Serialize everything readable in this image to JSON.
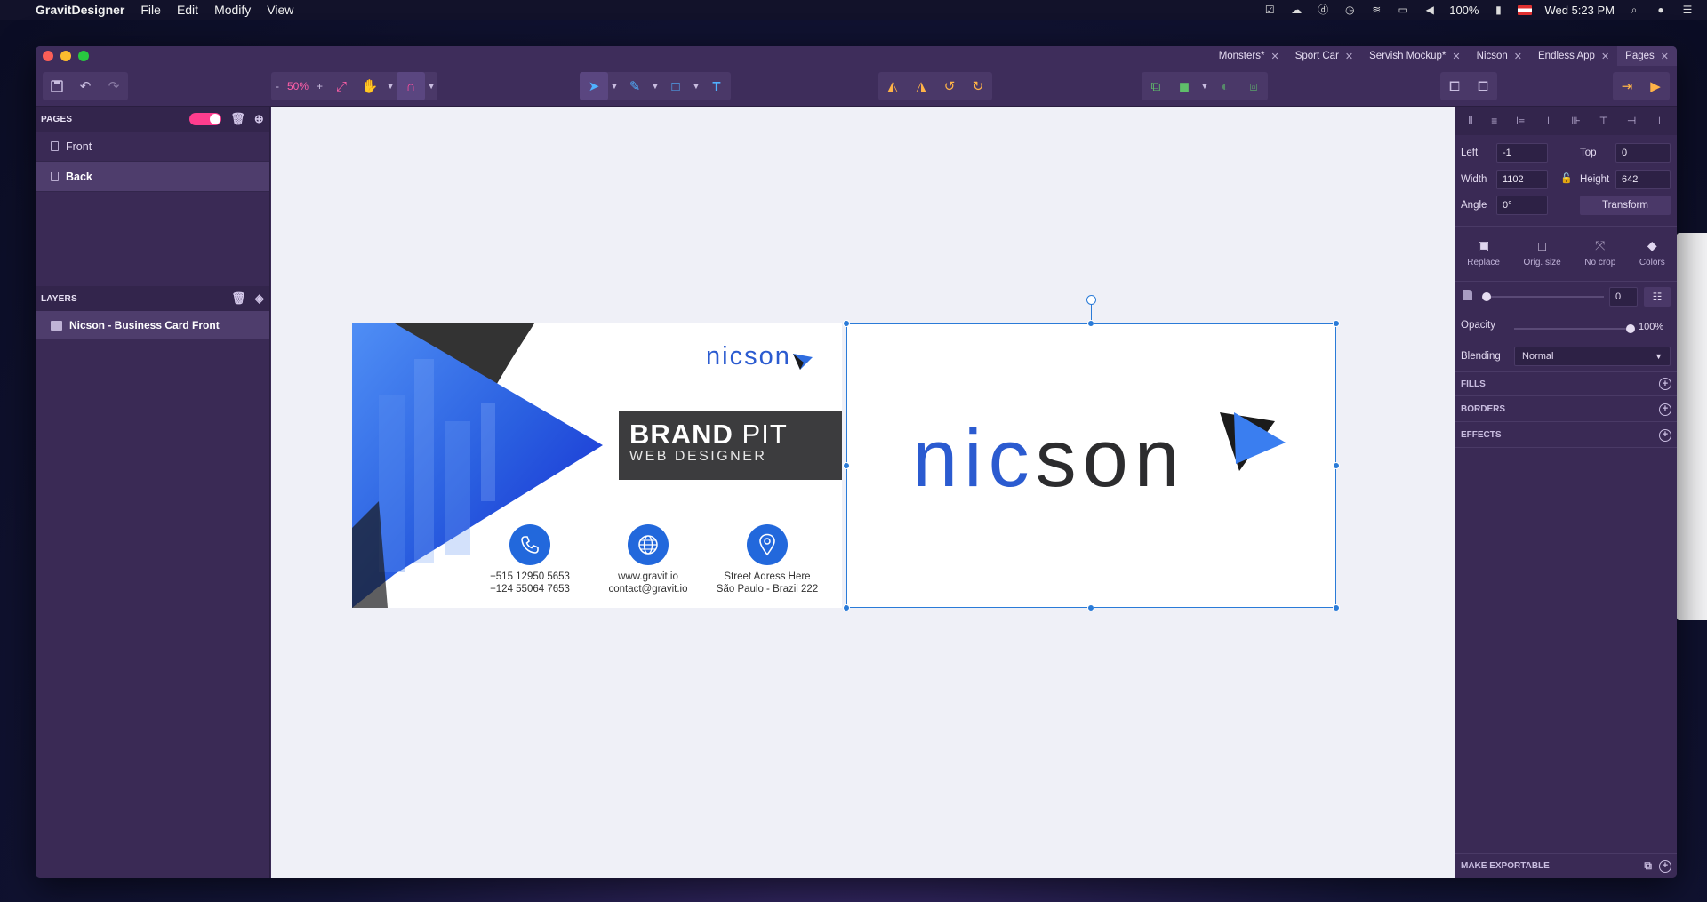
{
  "menubar": {
    "app_name": "GravitDesigner",
    "menus": [
      "File",
      "Edit",
      "Modify",
      "View"
    ],
    "battery": "100%",
    "clock": "Wed 5:23 PM"
  },
  "tabs": [
    {
      "label": "Monsters*",
      "active": false
    },
    {
      "label": "Sport Car",
      "active": false
    },
    {
      "label": "Servish Mockup*",
      "active": false
    },
    {
      "label": "Nicson",
      "active": false
    },
    {
      "label": "Endless App",
      "active": false
    },
    {
      "label": "Pages",
      "active": true
    }
  ],
  "toolbar": {
    "zoom_minus": "-",
    "zoom_value": "50%",
    "zoom_plus": "+",
    "text_tool": "T"
  },
  "pages_panel": {
    "title": "PAGES",
    "pages": [
      {
        "label": "Front",
        "selected": false
      },
      {
        "label": "Back",
        "selected": true
      }
    ]
  },
  "layers_panel": {
    "title": "LAYERS",
    "layers": [
      {
        "label": "Nicson - Business Card Front"
      }
    ]
  },
  "card_front": {
    "logo": "nicson",
    "brand_bold": "BRAND",
    "brand_light": " PIT",
    "role": "WEB DESIGNER",
    "contacts": [
      {
        "line1": "+515 12950 5653",
        "line2": "+124 55064 7653"
      },
      {
        "line1": "www.gravit.io",
        "line2": "contact@gravit.io"
      },
      {
        "line1": "Street Adress Here",
        "line2": "São Paulo - Brazil 222"
      }
    ]
  },
  "card_back": {
    "logo_blue": "nic",
    "logo_dark": "son"
  },
  "inspector": {
    "left_label": "Left",
    "left_value": "-1",
    "top_label": "Top",
    "top_value": "0",
    "width_label": "Width",
    "width_value": "1102",
    "height_label": "Height",
    "height_value": "642",
    "angle_label": "Angle",
    "angle_value": "0°",
    "transform_label": "Transform",
    "image_tools": [
      "Replace",
      "Orig. size",
      "No crop",
      "Colors"
    ],
    "radius_value": "0",
    "opacity_label": "Opacity",
    "opacity_value": "100%",
    "blending_label": "Blending",
    "blending_value": "Normal",
    "sections": [
      "FILLS",
      "BORDERS",
      "EFFECTS"
    ],
    "make_exportable": "MAKE EXPORTABLE"
  }
}
